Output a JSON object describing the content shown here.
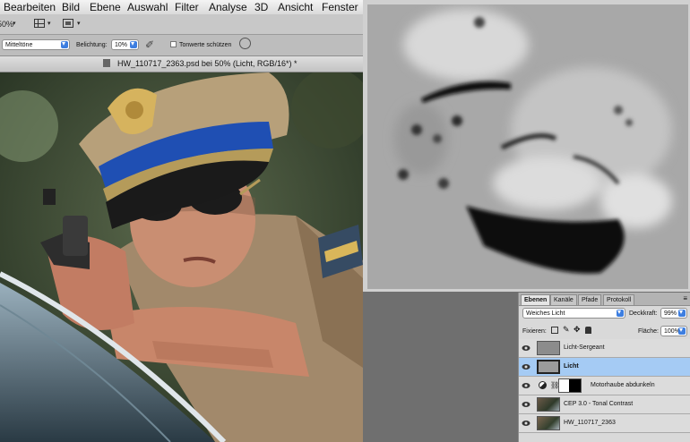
{
  "menu": [
    "Bearbeiten",
    "Bild",
    "Ebene",
    "Auswahl",
    "Filter",
    "Analyse",
    "3D",
    "Ansicht",
    "Fenster"
  ],
  "appbar": {
    "zoom": "50%"
  },
  "options": {
    "range_value": "Mitteltöne",
    "exposure_label": "Belichtung:",
    "exposure_value": "10%",
    "protect_tones_label": "Tonwerte schützen"
  },
  "document": {
    "title": "HW_110717_2363.psd bei 50% (Licht, RGB/16*) *"
  },
  "layers_panel": {
    "tabs": [
      "Ebenen",
      "Kanäle",
      "Pfade",
      "Protokoll"
    ],
    "blend_mode": "Weiches Licht",
    "opacity_label": "Deckkraft:",
    "opacity_value": "99%",
    "lock_label": "Fixieren:",
    "fill_label": "Fläche:",
    "fill_value": "100%",
    "layers": [
      {
        "name": "Licht-Sergeant",
        "selected": false
      },
      {
        "name": "Licht",
        "selected": true
      },
      {
        "name": "Motorhaube abdunkeln",
        "selected": false
      },
      {
        "name": "CEP 3.0 - Tonal Contrast",
        "selected": false
      },
      {
        "name": "HW_110717_2363",
        "selected": false
      }
    ]
  },
  "colors": {
    "selection": "#a5cbf4",
    "accent": "#3d7ee0",
    "cap_band": "#1f4fb3"
  }
}
